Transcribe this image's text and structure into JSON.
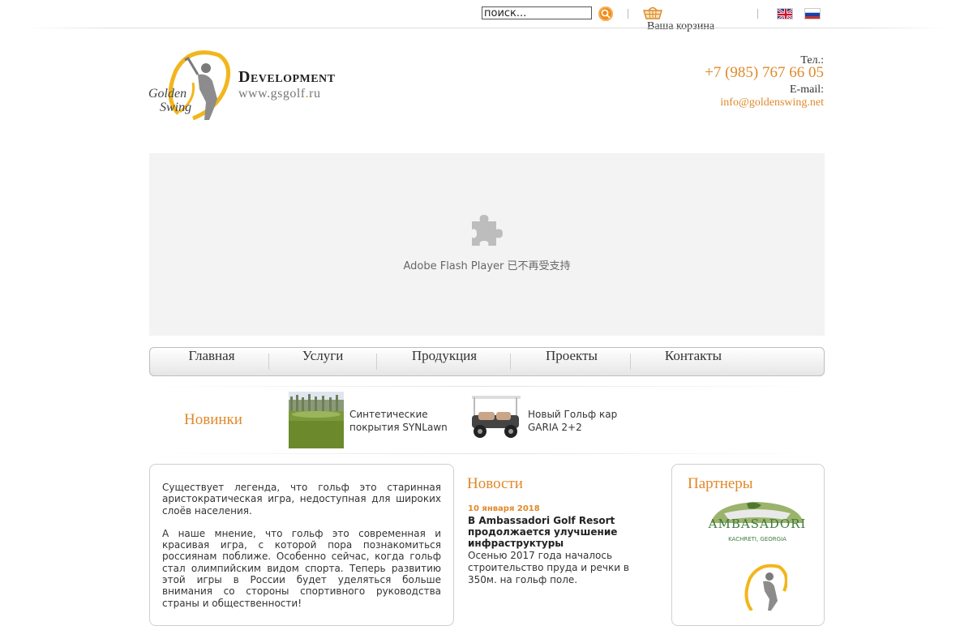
{
  "search": {
    "placeholder": "поиск...",
    "value": "поиск..."
  },
  "cart": {
    "label": "Ваша корзина"
  },
  "languages": [
    {
      "name": "english-flag"
    },
    {
      "name": "russian-flag"
    }
  ],
  "brand": {
    "logo_line1": "Golden",
    "logo_line2": "Swing",
    "title": "Development",
    "url_prefix": "www.gsgolf",
    "url_dot": ".",
    "url_suffix": "ru"
  },
  "contact": {
    "tel_label": "Тел.:",
    "tel": "+7 (985) 767 66 05",
    "email_label": "E-mail:",
    "email": "info@goldenswing.net"
  },
  "flash": {
    "message": "Adobe Flash Player 已不再受支持"
  },
  "nav": [
    {
      "label": "Главная"
    },
    {
      "label": "Услуги"
    },
    {
      "label": "Продукция"
    },
    {
      "label": "Проекты"
    },
    {
      "label": "Контакты"
    }
  ],
  "novelties": {
    "title": "Новинки",
    "items": [
      {
        "line1": "Синтетические",
        "line2": "покрытия SYNLawn"
      },
      {
        "line1": "Новый Гольф кар",
        "line2": "GARIA 2+2"
      }
    ]
  },
  "intro": {
    "p1": "Существует легенда, что гольф это старинная аристократическая игра, недоступная для широких слоёв населения.",
    "p2": "А наше мнение, что гольф это современная и красивая игра, с которой пора познакомиться россиянам поближе. Особенно сейчас, когда гольф стал олимпийским видом спорта. Теперь развитию этой игры в России будет уделяться больше внимания со стороны спортивного руководства страны и общественности!"
  },
  "news": {
    "title": "Новости",
    "date": "10 января 2018",
    "headline": "В Ambassadori Golf Resort продолжается улучшение инфраструктуры",
    "body": "Осенью 2017 года началось строительство пруда и речки в 350м. на гольф поле."
  },
  "partners": {
    "title": "Партнеры",
    "ambassadori_logo_text": "AMBASADORI",
    "ambassadori_logo_sub": "KACHRETI, GEORGIA"
  },
  "colors": {
    "accent": "#e0892a",
    "search_button": "#f08c1a"
  }
}
